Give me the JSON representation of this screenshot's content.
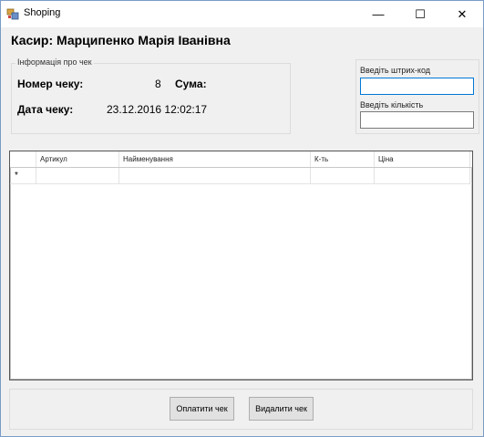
{
  "window": {
    "title": "Shoping",
    "minimize_glyph": "—",
    "maximize_glyph": "☐",
    "close_glyph": "✕"
  },
  "cashier": {
    "text": "Касир: Марципенко Марія Іванівна"
  },
  "receipt_info": {
    "group_title": "Інформація про чек",
    "number_label": "Номер чеку:",
    "number_value": "8",
    "sum_label": "Сума:",
    "sum_value": "",
    "date_label": "Дата чеку:",
    "date_value": "23.12.2016 12:02:17"
  },
  "input_panel": {
    "barcode_label": "Введіть штрих-код",
    "barcode_value": "",
    "quantity_label": "Введіть кількість",
    "quantity_value": ""
  },
  "grid": {
    "columns": [
      "Артикул",
      "Найменування",
      "К-ть",
      "Ціна"
    ],
    "new_row_marker": "*"
  },
  "actions": {
    "pay_label": "Оплатити чек",
    "delete_label": "Видалити чек"
  },
  "colors": {
    "window_border": "#7a9cc6",
    "focus_border": "#0078d7",
    "face": "#f0f0f0"
  }
}
